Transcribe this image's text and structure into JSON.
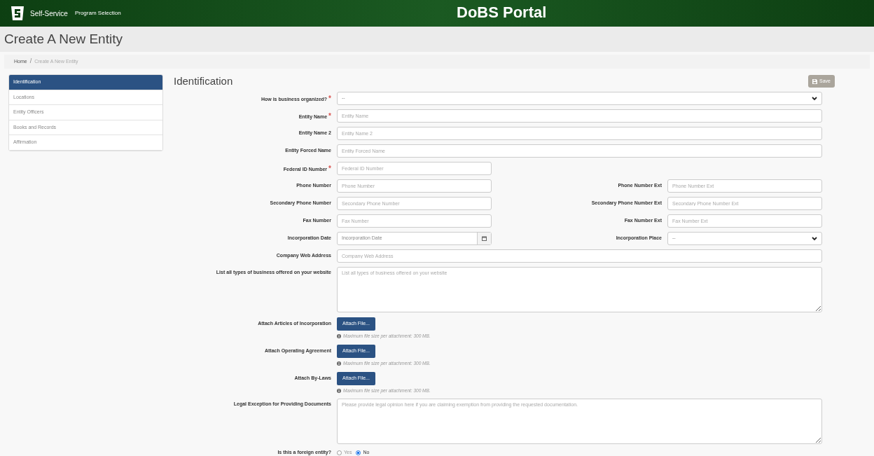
{
  "header": {
    "app_name": "Self-Service",
    "nav_link": "Program Selection",
    "portal_title": "DoBS Portal"
  },
  "page_title": "Create A New Entity",
  "breadcrumb_separator": "/",
  "required_mark": "*",
  "breadcrumb": [
    {
      "label": "Home",
      "kind": "link"
    },
    {
      "label": "Create A New Entity",
      "kind": "current"
    }
  ],
  "sidebar": {
    "items": [
      {
        "label": "Identification",
        "selected": true
      },
      {
        "label": "Locations",
        "selected": false
      },
      {
        "label": "Entity Officers",
        "selected": false
      },
      {
        "label": "Books and Records",
        "selected": false
      },
      {
        "label": "Affirmation",
        "selected": false
      }
    ]
  },
  "section_title": "Identification",
  "save_button": {
    "label": "Save",
    "disabled": true
  },
  "form_rows": [
    {
      "kind": "select",
      "label": "How is business organized?",
      "required": true,
      "value": "--"
    },
    {
      "kind": "text",
      "label": "Entity Name",
      "required": true,
      "placeholder": "Entity Name"
    },
    {
      "kind": "text",
      "label": "Entity Name 2",
      "required": false,
      "placeholder": "Entity Name 2"
    },
    {
      "kind": "text",
      "label": "Entity Forced Name",
      "required": false,
      "placeholder": "Entity Forced Name"
    },
    {
      "kind": "short_text",
      "label": "Federal ID Number",
      "required": true,
      "placeholder": "Federal ID Number"
    },
    {
      "kind": "pair",
      "left": {
        "kind": "text",
        "label": "Phone Number",
        "placeholder": "Phone Number"
      },
      "right": {
        "kind": "text",
        "label": "Phone Number Ext",
        "placeholder": "Phone Number Ext"
      }
    },
    {
      "kind": "pair",
      "left": {
        "kind": "text",
        "label": "Secondary Phone Number",
        "placeholder": "Secondary Phone Number"
      },
      "right": {
        "kind": "text",
        "label": "Secondary Phone Number Ext",
        "placeholder": "Secondary Phone Number Ext"
      }
    },
    {
      "kind": "pair",
      "left": {
        "kind": "text",
        "label": "Fax Number",
        "placeholder": "Fax Number"
      },
      "right": {
        "kind": "text",
        "label": "Fax Number Ext",
        "placeholder": "Fax Number Ext"
      }
    },
    {
      "kind": "pair",
      "left": {
        "kind": "date",
        "label": "Incorporation Date",
        "placeholder": "Incorporation Date"
      },
      "right": {
        "kind": "select",
        "label": "Incorporation Place",
        "value": "--"
      }
    },
    {
      "kind": "text",
      "label": "Company Web Address",
      "required": false,
      "placeholder": "Company Web Address"
    },
    {
      "kind": "textarea",
      "label": "List all types of business offered on your website",
      "placeholder": "List all types of business offered on your website"
    },
    {
      "kind": "attach",
      "label": "Attach Articles of Incorporation",
      "button": "Attach File...",
      "help": "Maximum file size per attachment: 300 MB."
    },
    {
      "kind": "attach",
      "label": "Attach Operating Agreement",
      "button": "Attach File...",
      "help": "Maximum file size per attachment: 300 MB."
    },
    {
      "kind": "attach",
      "label": "Attach By-Laws",
      "button": "Attach File...",
      "help": "Maximum file size per attachment: 300 MB."
    },
    {
      "kind": "textarea",
      "label": "Legal Exception for Providing Documents",
      "placeholder": "Please provide legal opinion here if you are claiming exemption from providing the requested documentation."
    },
    {
      "kind": "radio",
      "label": "Is this a foreign entity?",
      "options": [
        {
          "label": "Yes",
          "selected": false
        },
        {
          "label": "No",
          "selected": true
        }
      ]
    }
  ]
}
